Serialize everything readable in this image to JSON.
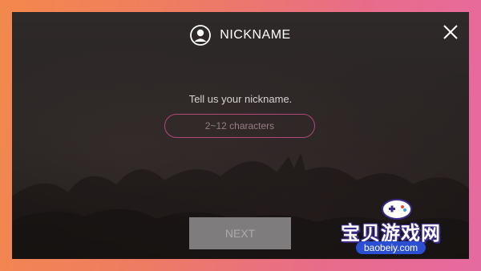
{
  "modal": {
    "title": "NICKNAME",
    "prompt": "Tell us your nickname.",
    "nickname_field": {
      "value": "",
      "placeholder": "2~12 characters"
    },
    "next_label": "NEXT",
    "icons": {
      "title_icon": "user-icon",
      "close": "close-icon"
    }
  },
  "watermark": {
    "text": "宝贝游戏网",
    "url": "baobeiy.com"
  },
  "colors": {
    "accent_border": "#b1477a",
    "button_disabled": "#7e7c7c",
    "background_gradient": [
      "#f2894c",
      "#e56aa0"
    ]
  }
}
